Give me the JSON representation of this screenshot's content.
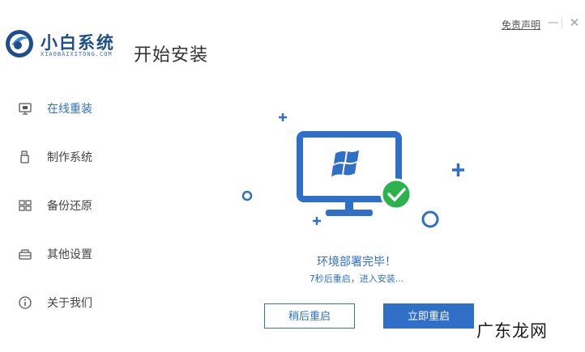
{
  "header": {
    "brand_name": "小白系统",
    "brand_sub": "XIAOBAIXITONG.COM",
    "page_title": "开始安装",
    "disclaimer": "免责声明",
    "minimize_glyph": "—",
    "close_glyph": "✕"
  },
  "sidebar": {
    "items": [
      {
        "label": "在线重装",
        "icon": "monitor-icon",
        "active": true
      },
      {
        "label": "制作系统",
        "icon": "usb-drive-icon",
        "active": false
      },
      {
        "label": "备份还原",
        "icon": "backup-icon",
        "active": false
      },
      {
        "label": "其他设置",
        "icon": "settings-box-icon",
        "active": false
      },
      {
        "label": "关于我们",
        "icon": "info-icon",
        "active": false
      }
    ]
  },
  "main": {
    "status": "环境部署完毕！",
    "countdown": "7秒后重启，进入安装...",
    "buttons": {
      "later": "稍后重启",
      "now": "立即重启"
    }
  },
  "watermark": "广东龙网",
  "colors": {
    "accent": "#2f6fc8",
    "success": "#2bb24c",
    "brand": "#1f4e8c"
  }
}
